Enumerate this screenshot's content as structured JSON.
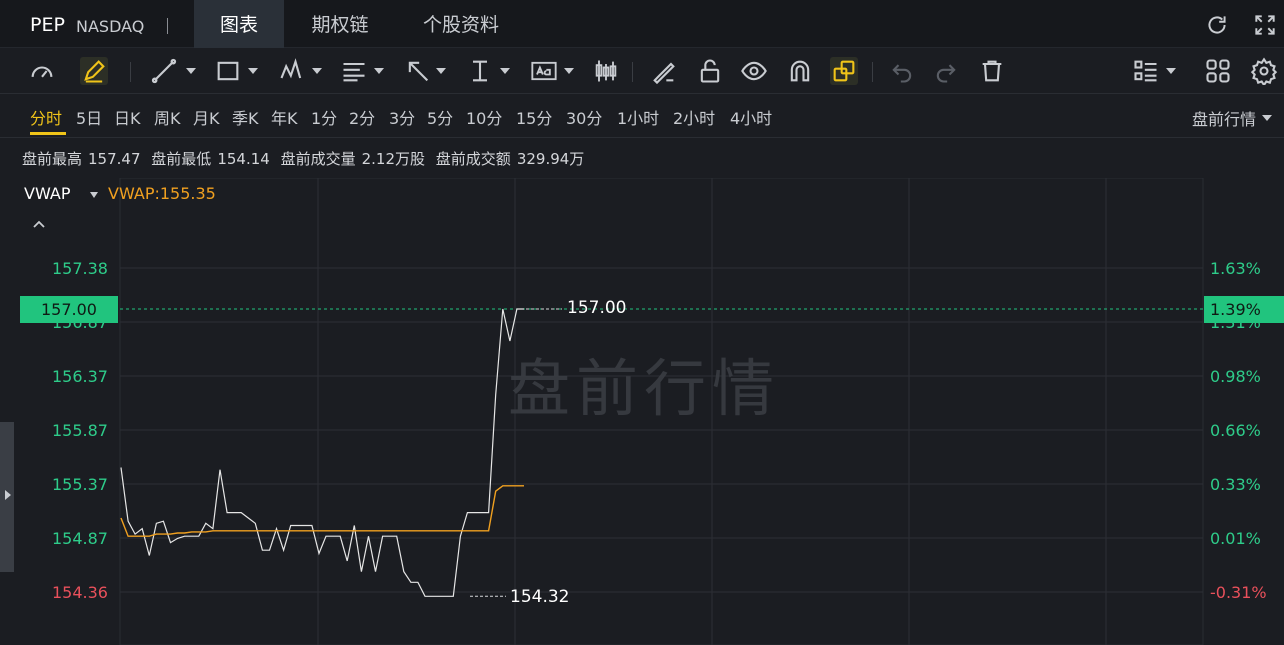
{
  "header": {
    "symbol": "PEP",
    "exchange": "NASDAQ",
    "tabs": [
      {
        "label": "图表",
        "active": true
      },
      {
        "label": "期权链",
        "active": false
      },
      {
        "label": "个股资料",
        "active": false
      }
    ]
  },
  "periods": {
    "items": [
      "分时",
      "5日",
      "日K",
      "周K",
      "月K",
      "季K",
      "年K",
      "1分",
      "2分",
      "3分",
      "5分",
      "10分",
      "15分",
      "30分",
      "1小时",
      "2小时",
      "4小时"
    ],
    "active": "分时",
    "session_selector": "盘前行情"
  },
  "stats": {
    "high_label": "盘前最高",
    "high_value": "157.47",
    "low_label": "盘前最低",
    "low_value": "154.14",
    "volume_label": "盘前成交量",
    "volume_value": "2.12万股",
    "turnover_label": "盘前成交额",
    "turnover_value": "329.94万"
  },
  "indicator": {
    "name": "VWAP",
    "value_text": "VWAP:155.35"
  },
  "chart_data": {
    "type": "line",
    "watermark": "盘前行情",
    "y_left_ticks": [
      "157.38",
      "156.87",
      "156.37",
      "155.87",
      "155.37",
      "154.87",
      "154.36"
    ],
    "y_right_ticks": [
      "1.63%",
      "1.31%",
      "0.98%",
      "0.66%",
      "0.33%",
      "0.01%",
      "-0.31%"
    ],
    "ylim": [
      154.36,
      157.38
    ],
    "current_price": "157.00",
    "current_pct": "1.39%",
    "min_annotation": "154.32",
    "max_annotation": "157.00",
    "series": [
      {
        "name": "price",
        "color": "#e6e6e6",
        "values": [
          155.52,
          155.02,
          154.9,
          154.95,
          154.7,
          155.0,
          155.02,
          154.82,
          154.86,
          154.88,
          154.88,
          154.88,
          155.0,
          154.95,
          155.5,
          155.1,
          155.1,
          155.1,
          155.05,
          155.0,
          154.75,
          154.75,
          154.95,
          154.75,
          154.98,
          154.98,
          154.98,
          154.98,
          154.72,
          154.88,
          154.88,
          154.88,
          154.65,
          154.98,
          154.55,
          154.88,
          154.55,
          154.88,
          154.88,
          154.88,
          154.55,
          154.45,
          154.45,
          154.32,
          154.32,
          154.32,
          154.32,
          154.32,
          154.88,
          155.1,
          155.1,
          155.1,
          155.1,
          156.2,
          157.0,
          156.7,
          157.0,
          157.0
        ]
      },
      {
        "name": "VWAP",
        "color": "#f0a020",
        "values": [
          155.05,
          154.88,
          154.88,
          154.88,
          154.88,
          154.9,
          154.9,
          154.9,
          154.91,
          154.91,
          154.92,
          154.92,
          154.92,
          154.93,
          154.93,
          154.93,
          154.93,
          154.93,
          154.93,
          154.93,
          154.93,
          154.93,
          154.93,
          154.93,
          154.93,
          154.93,
          154.93,
          154.93,
          154.93,
          154.93,
          154.93,
          154.93,
          154.93,
          154.93,
          154.93,
          154.93,
          154.93,
          154.93,
          154.93,
          154.93,
          154.93,
          154.93,
          154.93,
          154.93,
          154.93,
          154.93,
          154.93,
          154.93,
          154.93,
          154.93,
          154.93,
          154.93,
          154.93,
          155.3,
          155.35,
          155.35,
          155.35,
          155.35
        ]
      }
    ]
  }
}
